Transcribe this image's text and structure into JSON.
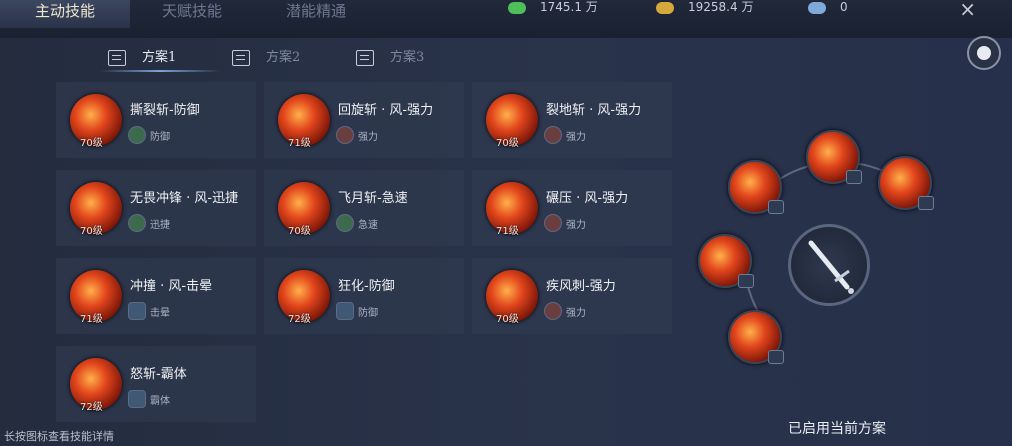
{
  "top_tabs": [
    {
      "label": "主动技能",
      "active": true
    },
    {
      "label": "天赋技能",
      "active": false
    },
    {
      "label": "潜能精通",
      "active": false
    }
  ],
  "resources": [
    {
      "icon": "crystal-icon",
      "value": "1745.1 万"
    },
    {
      "icon": "gold-icon",
      "value": "19258.4 万"
    },
    {
      "icon": "gem-icon",
      "value": "0"
    }
  ],
  "close_label": "×",
  "plans": [
    {
      "label": "方案1",
      "active": true
    },
    {
      "label": "方案2",
      "active": false
    },
    {
      "label": "方案3",
      "active": false
    }
  ],
  "skills": [
    {
      "name": "撕裂斩-防御",
      "level": "70级",
      "tag": "防御"
    },
    {
      "name": "回旋斩 · 风-强力",
      "level": "71级",
      "tag": "强力"
    },
    {
      "name": "裂地斩 · 风-强力",
      "level": "70级",
      "tag": "强力"
    },
    {
      "name": "无畏冲锋 · 风-迅捷",
      "level": "70级",
      "tag": "迅捷"
    },
    {
      "name": "飞月斩-急速",
      "level": "70级",
      "tag": "急速"
    },
    {
      "name": "碾压 · 风-强力",
      "level": "71级",
      "tag": "强力"
    },
    {
      "name": "冲撞 · 风-击晕",
      "level": "71级",
      "tag": "击晕"
    },
    {
      "name": "狂化-防御",
      "level": "72级",
      "tag": "防御"
    },
    {
      "name": "疾风刺-强力",
      "level": "70级",
      "tag": "强力"
    },
    {
      "name": "怒斩-霸体",
      "level": "72级",
      "tag": "霸体"
    }
  ],
  "footer": {
    "hint": "长按图标查看技能详情",
    "enabled_label": "已启用当前方案"
  },
  "colors": {
    "accent_orange": "#e2461c",
    "active_tab_text": "#f1e7cf",
    "panel_bg": "#29334a"
  }
}
